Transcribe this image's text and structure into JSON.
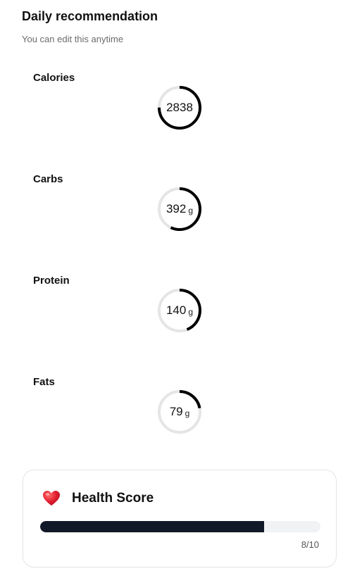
{
  "header": {
    "title": "Daily recommendation",
    "subtitle": "You can edit this anytime"
  },
  "macros": [
    {
      "label": "Calories",
      "value": "2838",
      "unit": "",
      "progress": 0.75
    },
    {
      "label": "Carbs",
      "value": "392",
      "unit": "g",
      "progress": 0.57
    },
    {
      "label": "Protein",
      "value": "140",
      "unit": "g",
      "progress": 0.44
    },
    {
      "label": "Fats",
      "value": "79",
      "unit": "g",
      "progress": 0.22
    }
  ],
  "health_score": {
    "title": "Health Score",
    "score_text": "8/10",
    "score": 8,
    "max": 10,
    "icon": "heart-icon"
  },
  "colors": {
    "ring_active": "#000000",
    "ring_track": "#e5e5e7",
    "bar_fill": "#111827",
    "bar_track": "#f1f2f4",
    "heart": "#e11d2e"
  }
}
